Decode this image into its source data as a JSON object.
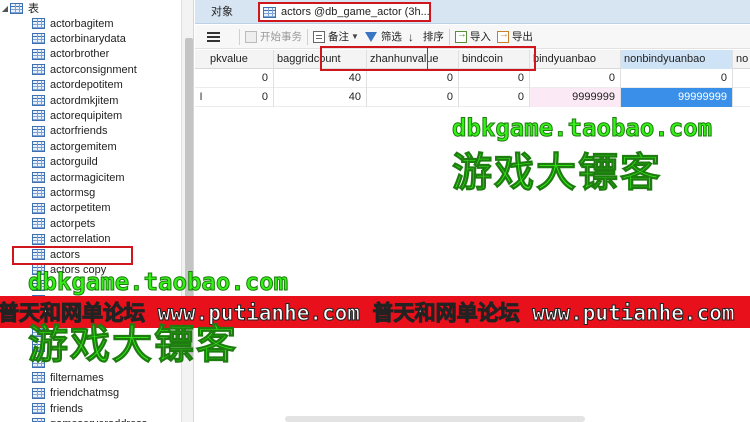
{
  "tree": {
    "root_label": "表",
    "items": [
      {
        "label": "actorbagitem"
      },
      {
        "label": "actorbinarydata"
      },
      {
        "label": "actorbrother"
      },
      {
        "label": "actorconsignment"
      },
      {
        "label": "actordepotitem"
      },
      {
        "label": "actordmkjitem"
      },
      {
        "label": "actorequipitem"
      },
      {
        "label": "actorfriends"
      },
      {
        "label": "actorgemitem"
      },
      {
        "label": "actorguild"
      },
      {
        "label": "actormagicitem"
      },
      {
        "label": "actormsg"
      },
      {
        "label": "actorpetitem"
      },
      {
        "label": "actorpets"
      },
      {
        "label": "actorrelation"
      },
      {
        "label": "actors"
      },
      {
        "label": "actors copy"
      },
      {
        "label": ""
      },
      {
        "label": ""
      },
      {
        "label": ""
      },
      {
        "label": ""
      },
      {
        "label": ""
      },
      {
        "label": ""
      },
      {
        "label": "filternames"
      },
      {
        "label": "friendchatmsg"
      },
      {
        "label": "friends"
      },
      {
        "label": "gameserveraddress"
      }
    ],
    "selected": "actors"
  },
  "tabs": {
    "objects_label": "对象",
    "active_label": "actors @db_game_actor (3h..."
  },
  "toolbar": {
    "begin_tx": "开始事务",
    "memo": "备注",
    "filter": "筛选",
    "sort": "排序",
    "import": "导入",
    "export": "导出"
  },
  "grid": {
    "columns": [
      "pkvalue",
      "baggridcount",
      "zhanhunvalue",
      "bindcoin",
      "bindyuanbao",
      "nonbindyuanbao",
      "no"
    ],
    "rows": [
      {
        "indicator": "",
        "cells": [
          "0",
          "40",
          "0",
          "0",
          "0",
          "0",
          ""
        ]
      },
      {
        "indicator": "I",
        "cells": [
          "0",
          "40",
          "0",
          "0",
          "9999999",
          "99999999",
          ""
        ]
      }
    ]
  },
  "watermarks": {
    "url": "dbkgame.taobao.com",
    "cn": "游戏大镖客",
    "banner": "普天和网单论坛 www.putianhe.com 普天和网单论坛 www.putianhe.com"
  }
}
